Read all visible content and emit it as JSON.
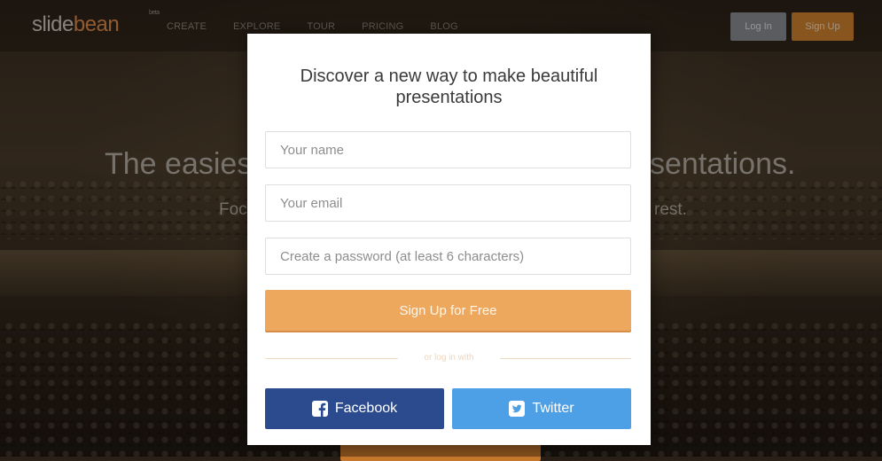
{
  "nav": {
    "logo_part1": "slide",
    "logo_part2": "bean",
    "logo_badge": "beta",
    "links": [
      "CREATE",
      "EXPLORE",
      "TOUR",
      "PRICING",
      "BLOG"
    ],
    "login_label": "Log In",
    "signup_label": "Sign Up"
  },
  "hero": {
    "title_left": "The easies",
    "title_right": "sentations.",
    "subtitle_left": "Foc",
    "subtitle_right": "rest."
  },
  "modal": {
    "title": "Discover a new way to make beautiful presentations",
    "name_placeholder": "Your name",
    "email_placeholder": "Your email",
    "password_placeholder": "Create a password (at least 6 characters)",
    "signup_button": "Sign Up for Free",
    "divider_text": "or log in with",
    "facebook_button": "Facebook",
    "twitter_button": "Twitter"
  },
  "colors": {
    "accent_orange": "#eea85e",
    "facebook_blue": "#2c4b8f",
    "twitter_blue": "#4d9fe6",
    "logo_orange": "#e08a4a"
  },
  "icons": {
    "facebook": "facebook-icon",
    "twitter": "twitter-icon"
  }
}
